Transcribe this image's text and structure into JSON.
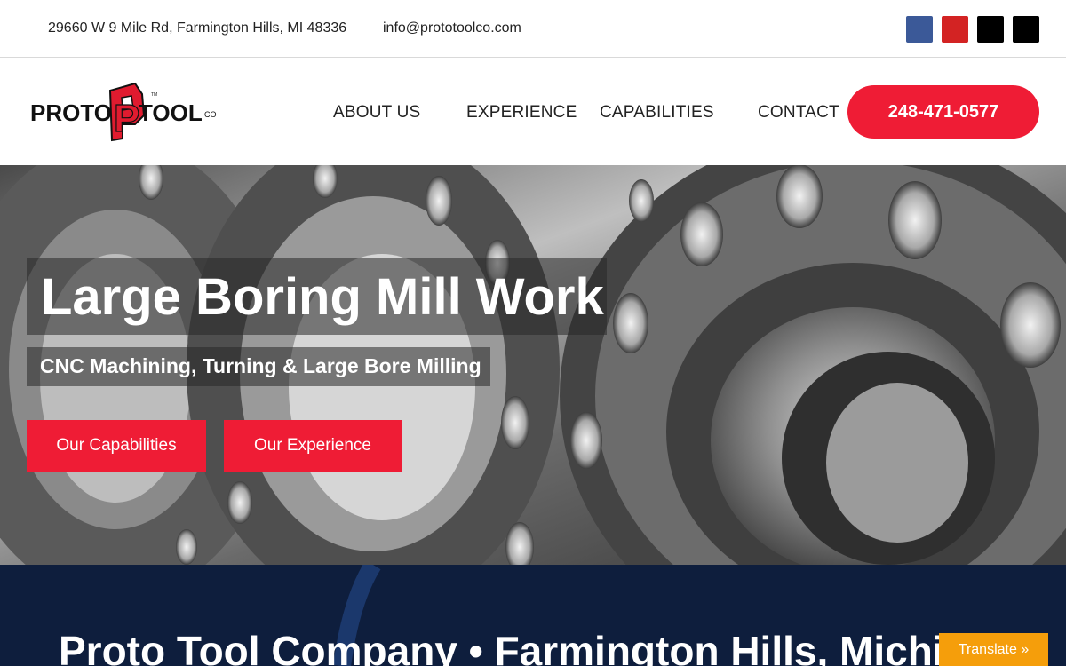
{
  "topbar": {
    "address": "29660 W 9 Mile Rd, Farmington Hills, MI 48336",
    "email": "info@prototoolco.com",
    "social": [
      {
        "icon": "facebook-icon",
        "color": "#3b5998"
      },
      {
        "icon": "yelp-icon",
        "color": "#d32323"
      },
      {
        "icon": "x-twitter-icon",
        "color": "#000000"
      },
      {
        "icon": "tiktok-icon",
        "color": "#000000"
      }
    ]
  },
  "header": {
    "logo": {
      "word_left": "PROTO",
      "letter": "P",
      "word_right": "TOOL",
      "suffix": "CO",
      "tm": "TM"
    },
    "nav": [
      "ABOUT US",
      "EXPERIENCE",
      "CAPABILITIES",
      "CONTACT"
    ],
    "phone": "248-471-0577"
  },
  "hero": {
    "title": "Large Boring Mill Work",
    "subtitle": "CNC Machining, Turning & Large Bore Milling",
    "buttons": [
      "Our Capabilities",
      "Our Experience"
    ]
  },
  "band": {
    "title": "Proto Tool Company • Farmington Hills, Michigan"
  },
  "translate": {
    "label": "Translate »"
  },
  "colors": {
    "accent": "#ef1c35",
    "band": "#0e1e3d",
    "translate": "#f59e0b"
  }
}
